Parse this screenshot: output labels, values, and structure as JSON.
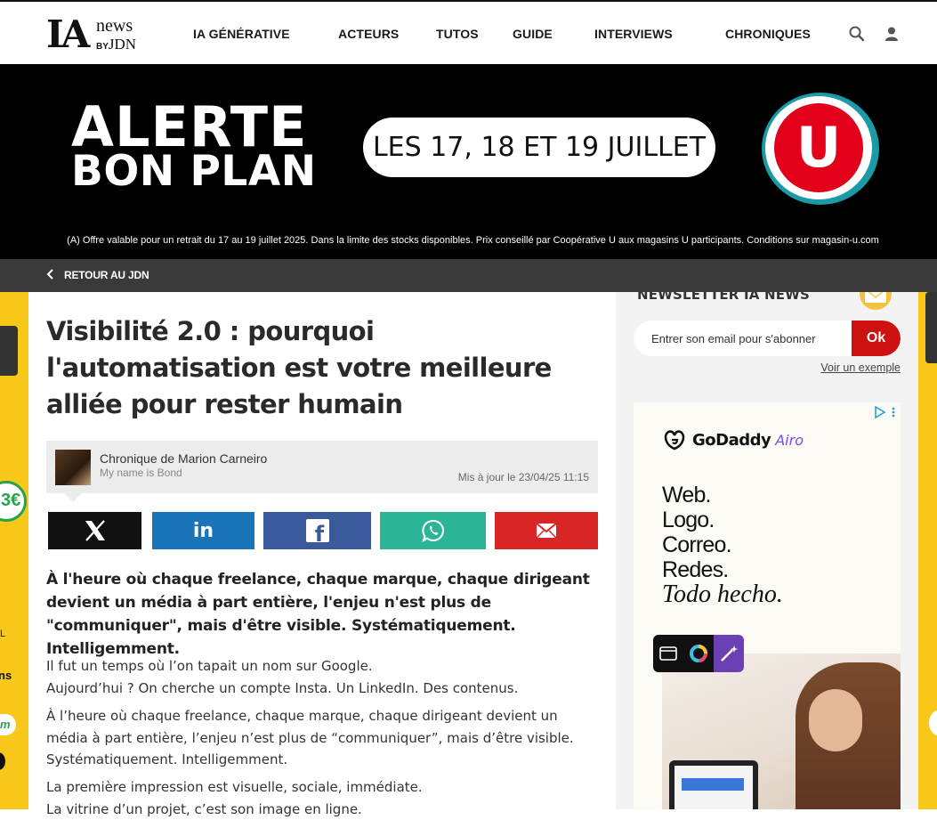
{
  "logo": {
    "ia": "IA",
    "news": "news",
    "by": "BY",
    "jdn": "JDN"
  },
  "nav": {
    "items": [
      {
        "label": "IA GÉNÉRATIVE"
      },
      {
        "label": "ACTEURS"
      },
      {
        "label": "TUTOS"
      },
      {
        "label": "GUIDE"
      },
      {
        "label": "INTERVIEWS"
      },
      {
        "label": "CHRONIQUES"
      }
    ],
    "search_icon": "search-icon",
    "user_icon": "user-icon"
  },
  "banner": {
    "headline_1": "ALERTE",
    "headline_2": "BON PLAN",
    "dates": "LES 17, 18 ET 19 JUILLET",
    "brand_letter": "U",
    "disclaimer": "(A) Offre valable pour un retrait du 17 au 19 juillet 2025. Dans la limite des stocks disponibles. Prix conseillé par Coopérative U aux magasins U participants. Conditions sur magasin-u.com",
    "colors": {
      "red": "#e2001a",
      "teal": "#1a9aa6"
    }
  },
  "backbar": {
    "label": "RETOUR AU JDN"
  },
  "article": {
    "title": "Visibilité 2.0 : pourquoi l'automatisation est votre meilleure alliée pour rester humain",
    "author": "Chronique de Marion Carneiro",
    "author_sub": "My name is Bond",
    "updated": "Mis à jour le 23/04/25 11:15",
    "lead": "À l'heure où chaque freelance, chaque marque, chaque dirigeant devient un média à part entière, l'enjeu n'est plus de \"communiquer\", mais d'être visible. Systématiquement. Intelligemment.",
    "p1_l1": "Il fut un temps où l’on tapait un nom sur Google.",
    "p1_l2": "Aujourd’hui ? On cherche un compte Insta. Un LinkedIn. Des contenus.",
    "p2": "À l’heure où chaque freelance, chaque marque, chaque dirigeant devient un média à part entière, l’enjeu n’est plus de “communiquer”, mais d’être visible. Systématiquement. Intelligemment.",
    "p3_l1": "La première impression est visuelle, sociale, immédiate.",
    "p3_l2": "La vitrine d’un projet, c’est son image en ligne."
  },
  "share": {
    "buttons": [
      {
        "name": "x",
        "color": "#111111"
      },
      {
        "name": "linkedin",
        "color": "#1a75b8"
      },
      {
        "name": "facebook",
        "color": "#3a5a9b"
      },
      {
        "name": "whatsapp",
        "color": "#2bb596"
      },
      {
        "name": "email",
        "color": "#d92525"
      }
    ],
    "x_glyph": "X",
    "linkedin_glyph": "in",
    "facebook_glyph": "f"
  },
  "newsletter": {
    "heading": "NEWSLETTER IA NEWS",
    "placeholder": "Entrer son email pour s'abonner",
    "ok": "Ok",
    "example": "Voir un exemple"
  },
  "ad": {
    "brand": "GoDaddy",
    "product": "Airo",
    "lines": [
      "Web.",
      "Logo.",
      "Correo.",
      "Redes."
    ],
    "last": "Todo hecho."
  },
  "side_ads": {
    "left_price": "3€",
    "left_letter_1": "L",
    "left_letter_2": "ns",
    "left_letter_3": "m"
  }
}
